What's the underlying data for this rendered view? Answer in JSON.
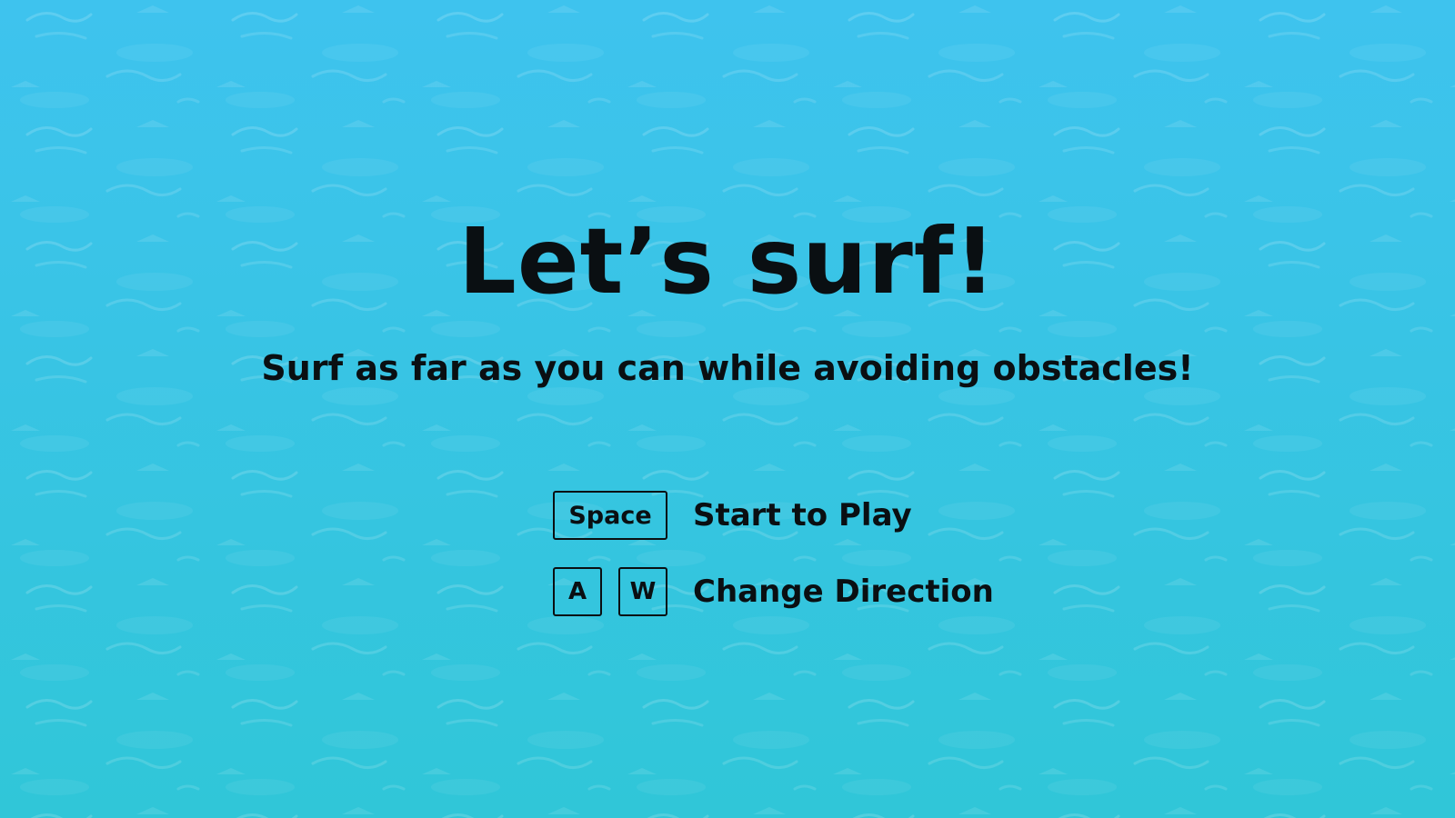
{
  "title": "Let’s surf!",
  "subtitle": "Surf as far as you can while avoiding obstacles!",
  "controls": [
    {
      "keys": [
        "Space"
      ],
      "label": "Start to Play"
    },
    {
      "keys": [
        "A",
        "W"
      ],
      "label": "Change Direction"
    }
  ],
  "colors": {
    "water_top": "#3ec3ee",
    "water_bottom": "#30c6d8",
    "text": "#0a0f12"
  }
}
